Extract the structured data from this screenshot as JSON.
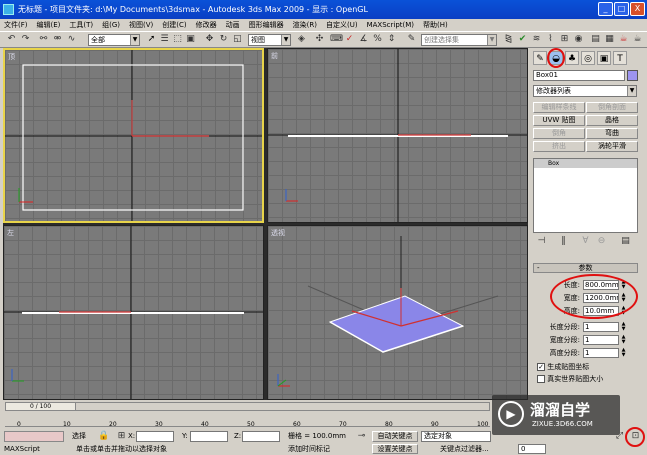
{
  "window": {
    "title": "无标题  - 项目文件夹: d:\\My Documents\\3dsmax    - Autodesk 3ds Max   2009    - 显示 : OpenGL",
    "minimize": "_",
    "maximize": "□",
    "close": "X"
  },
  "menu": [
    "文件(F)",
    "编辑(E)",
    "工具(T)",
    "组(G)",
    "视图(V)",
    "创建(C)",
    "修改器",
    "动画",
    "图形编辑器",
    "渲染(R)",
    "自定义(U)",
    "MAXScript(M)",
    "帮助(H)"
  ],
  "toolbar": {
    "selection_filter": "全部",
    "ref_coord": "视图",
    "named_selection": "创建选择集"
  },
  "viewports": {
    "top_label": "顶",
    "front_label": "前",
    "left_label": "左",
    "persp_label": "透视"
  },
  "command_panel": {
    "object_name": "Box01",
    "modifier_list": "修改器列表",
    "buttons": [
      "编辑样条线",
      "倒角剖面",
      "UVW 贴图",
      "晶格",
      "倒角",
      "弯曲",
      "挤出",
      "涡轮平滑"
    ],
    "stack_item": "Box",
    "rollout_title": "参数",
    "params": [
      {
        "label": "长度:",
        "value": "800.0mm"
      },
      {
        "label": "宽度:",
        "value": "1200.0mm"
      },
      {
        "label": "高度:",
        "value": "10.0mm"
      },
      {
        "label": "长度分段:",
        "value": "1"
      },
      {
        "label": "宽度分段:",
        "value": "1"
      },
      {
        "label": "高度分段:",
        "value": "1"
      }
    ],
    "checkbox_gen_uv": "生成贴图坐标",
    "checkbox_real_world": "真实世界贴图大小",
    "gen_uv_checked": true,
    "real_world_checked": false
  },
  "timeline": {
    "frame_display": "0 / 100",
    "ticks": [
      "0",
      "10",
      "20",
      "30",
      "40",
      "50",
      "60",
      "70",
      "80",
      "90",
      "100"
    ]
  },
  "status": {
    "selection": "选择",
    "x_label": "X:",
    "y_label": "Y:",
    "z_label": "Z:",
    "grid": "栅格 = 100.0mm",
    "autokey": "自动关键点",
    "selected_obj": "选定对象",
    "setkey": "设置关键点",
    "key_filter": "关键点过滤器...",
    "frame": "0",
    "prompt": "单击或单击并拖动以选择对象",
    "add_time_tag": "添加时间标记",
    "maxscript": "MAXScript"
  },
  "watermark": {
    "brand": "溜溜自学",
    "url": "ZIXUE.3D66.COM"
  },
  "colors": {
    "title_bar": "#0a4ad0",
    "viewport_bg": "#7a7a7a",
    "active_border": "#e8d44a",
    "object_color": "#8a86e8",
    "object_name_swatch": "#9d94f0",
    "annotation_red": "#e01010"
  }
}
